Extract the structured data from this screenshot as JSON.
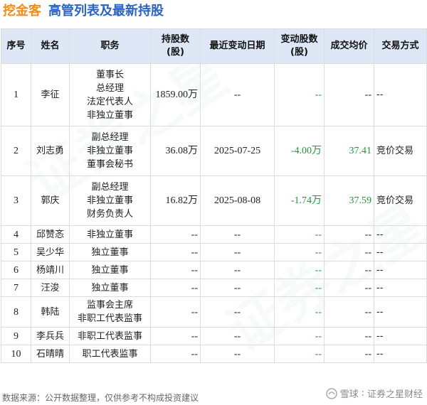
{
  "header": {
    "brand": "挖金客",
    "title": "高管列表及最新持股"
  },
  "table": {
    "headers": [
      "序号",
      "姓名",
      "职务",
      "持股数\n(股)",
      "最近变动日期",
      "变动股数\n(股)",
      "成交均价",
      "交易方式"
    ],
    "rows": [
      {
        "seq": "1",
        "name": "李征",
        "roles": [
          "董事长",
          "总经理",
          "法定代表人",
          "非独立董事"
        ],
        "shares": "1859.00万",
        "date": "--",
        "change": "--",
        "price": "--",
        "method": "--"
      },
      {
        "seq": "2",
        "name": "刘志勇",
        "roles": [
          "副总经理",
          "非独立董事",
          "董事会秘书"
        ],
        "shares": "36.08万",
        "date": "2025-07-25",
        "change": "-4.00万",
        "price": "37.41",
        "method": "竞价交易"
      },
      {
        "seq": "3",
        "name": "郭庆",
        "roles": [
          "副总经理",
          "非独立董事",
          "财务负责人"
        ],
        "shares": "16.82万",
        "date": "2025-08-08",
        "change": "-1.74万",
        "price": "37.59",
        "method": "竞价交易"
      },
      {
        "seq": "4",
        "name": "邱赞忞",
        "roles": [
          "非独立董事"
        ],
        "shares": "--",
        "date": "--",
        "change": "--",
        "price": "--",
        "method": "--"
      },
      {
        "seq": "5",
        "name": "吴少华",
        "roles": [
          "独立董事"
        ],
        "shares": "--",
        "date": "--",
        "change": "--",
        "price": "--",
        "method": "--"
      },
      {
        "seq": "6",
        "name": "杨靖川",
        "roles": [
          "独立董事"
        ],
        "shares": "--",
        "date": "--",
        "change": "--",
        "price": "--",
        "method": "--"
      },
      {
        "seq": "7",
        "name": "汪浚",
        "roles": [
          "独立董事"
        ],
        "shares": "--",
        "date": "--",
        "change": "--",
        "price": "--",
        "method": "--"
      },
      {
        "seq": "8",
        "name": "韩陆",
        "roles": [
          "监事会主席",
          "非职工代表监事"
        ],
        "shares": "--",
        "date": "--",
        "change": "--",
        "price": "--",
        "method": "--"
      },
      {
        "seq": "9",
        "name": "李兵兵",
        "roles": [
          "非职工代表监事"
        ],
        "shares": "--",
        "date": "--",
        "change": "--",
        "price": "--",
        "method": "--"
      },
      {
        "seq": "10",
        "name": "石晴晴",
        "roles": [
          "职工代表监事"
        ],
        "shares": "--",
        "date": "--",
        "change": "--",
        "price": "--",
        "method": "--"
      }
    ]
  },
  "footer": {
    "source": "数据来源：公开数据整理，仅供参考不构成投资建议",
    "logo_icon": "snowball-icon",
    "platform": "雪球",
    "account": "证券之星财经"
  },
  "colors": {
    "brand": "#f28c1a",
    "title": "#2a64c5",
    "header_bg": "#dde7f6",
    "negative": "#1f9a3a"
  }
}
